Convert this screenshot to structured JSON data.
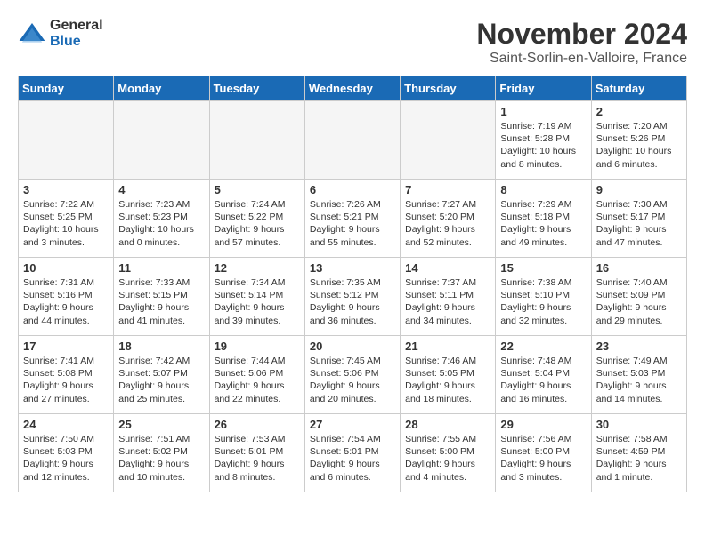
{
  "logo": {
    "general": "General",
    "blue": "Blue"
  },
  "header": {
    "month": "November 2024",
    "location": "Saint-Sorlin-en-Valloire, France"
  },
  "weekdays": [
    "Sunday",
    "Monday",
    "Tuesday",
    "Wednesday",
    "Thursday",
    "Friday",
    "Saturday"
  ],
  "weeks": [
    [
      {
        "day": "",
        "info": ""
      },
      {
        "day": "",
        "info": ""
      },
      {
        "day": "",
        "info": ""
      },
      {
        "day": "",
        "info": ""
      },
      {
        "day": "",
        "info": ""
      },
      {
        "day": "1",
        "info": "Sunrise: 7:19 AM\nSunset: 5:28 PM\nDaylight: 10 hours\nand 8 minutes."
      },
      {
        "day": "2",
        "info": "Sunrise: 7:20 AM\nSunset: 5:26 PM\nDaylight: 10 hours\nand 6 minutes."
      }
    ],
    [
      {
        "day": "3",
        "info": "Sunrise: 7:22 AM\nSunset: 5:25 PM\nDaylight: 10 hours\nand 3 minutes."
      },
      {
        "day": "4",
        "info": "Sunrise: 7:23 AM\nSunset: 5:23 PM\nDaylight: 10 hours\nand 0 minutes."
      },
      {
        "day": "5",
        "info": "Sunrise: 7:24 AM\nSunset: 5:22 PM\nDaylight: 9 hours\nand 57 minutes."
      },
      {
        "day": "6",
        "info": "Sunrise: 7:26 AM\nSunset: 5:21 PM\nDaylight: 9 hours\nand 55 minutes."
      },
      {
        "day": "7",
        "info": "Sunrise: 7:27 AM\nSunset: 5:20 PM\nDaylight: 9 hours\nand 52 minutes."
      },
      {
        "day": "8",
        "info": "Sunrise: 7:29 AM\nSunset: 5:18 PM\nDaylight: 9 hours\nand 49 minutes."
      },
      {
        "day": "9",
        "info": "Sunrise: 7:30 AM\nSunset: 5:17 PM\nDaylight: 9 hours\nand 47 minutes."
      }
    ],
    [
      {
        "day": "10",
        "info": "Sunrise: 7:31 AM\nSunset: 5:16 PM\nDaylight: 9 hours\nand 44 minutes."
      },
      {
        "day": "11",
        "info": "Sunrise: 7:33 AM\nSunset: 5:15 PM\nDaylight: 9 hours\nand 41 minutes."
      },
      {
        "day": "12",
        "info": "Sunrise: 7:34 AM\nSunset: 5:14 PM\nDaylight: 9 hours\nand 39 minutes."
      },
      {
        "day": "13",
        "info": "Sunrise: 7:35 AM\nSunset: 5:12 PM\nDaylight: 9 hours\nand 36 minutes."
      },
      {
        "day": "14",
        "info": "Sunrise: 7:37 AM\nSunset: 5:11 PM\nDaylight: 9 hours\nand 34 minutes."
      },
      {
        "day": "15",
        "info": "Sunrise: 7:38 AM\nSunset: 5:10 PM\nDaylight: 9 hours\nand 32 minutes."
      },
      {
        "day": "16",
        "info": "Sunrise: 7:40 AM\nSunset: 5:09 PM\nDaylight: 9 hours\nand 29 minutes."
      }
    ],
    [
      {
        "day": "17",
        "info": "Sunrise: 7:41 AM\nSunset: 5:08 PM\nDaylight: 9 hours\nand 27 minutes."
      },
      {
        "day": "18",
        "info": "Sunrise: 7:42 AM\nSunset: 5:07 PM\nDaylight: 9 hours\nand 25 minutes."
      },
      {
        "day": "19",
        "info": "Sunrise: 7:44 AM\nSunset: 5:06 PM\nDaylight: 9 hours\nand 22 minutes."
      },
      {
        "day": "20",
        "info": "Sunrise: 7:45 AM\nSunset: 5:06 PM\nDaylight: 9 hours\nand 20 minutes."
      },
      {
        "day": "21",
        "info": "Sunrise: 7:46 AM\nSunset: 5:05 PM\nDaylight: 9 hours\nand 18 minutes."
      },
      {
        "day": "22",
        "info": "Sunrise: 7:48 AM\nSunset: 5:04 PM\nDaylight: 9 hours\nand 16 minutes."
      },
      {
        "day": "23",
        "info": "Sunrise: 7:49 AM\nSunset: 5:03 PM\nDaylight: 9 hours\nand 14 minutes."
      }
    ],
    [
      {
        "day": "24",
        "info": "Sunrise: 7:50 AM\nSunset: 5:03 PM\nDaylight: 9 hours\nand 12 minutes."
      },
      {
        "day": "25",
        "info": "Sunrise: 7:51 AM\nSunset: 5:02 PM\nDaylight: 9 hours\nand 10 minutes."
      },
      {
        "day": "26",
        "info": "Sunrise: 7:53 AM\nSunset: 5:01 PM\nDaylight: 9 hours\nand 8 minutes."
      },
      {
        "day": "27",
        "info": "Sunrise: 7:54 AM\nSunset: 5:01 PM\nDaylight: 9 hours\nand 6 minutes."
      },
      {
        "day": "28",
        "info": "Sunrise: 7:55 AM\nSunset: 5:00 PM\nDaylight: 9 hours\nand 4 minutes."
      },
      {
        "day": "29",
        "info": "Sunrise: 7:56 AM\nSunset: 5:00 PM\nDaylight: 9 hours\nand 3 minutes."
      },
      {
        "day": "30",
        "info": "Sunrise: 7:58 AM\nSunset: 4:59 PM\nDaylight: 9 hours\nand 1 minute."
      }
    ]
  ]
}
